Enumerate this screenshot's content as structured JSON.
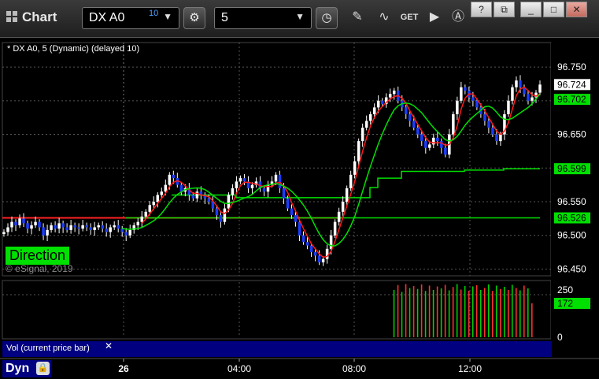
{
  "app": {
    "title": "Chart"
  },
  "toolbar": {
    "symbol": "DX A0",
    "symbol_superscript": "10",
    "interval": "5",
    "icons": [
      "gear-icon",
      "clock-icon",
      "pencil-icon",
      "study-icon",
      "get-icon",
      "play-icon",
      "alert-icon"
    ]
  },
  "window_buttons": [
    "?",
    "⧉",
    "_",
    "□",
    "✕"
  ],
  "chart_header": "* DX A0, 5 (Dynamic) (delayed 10)",
  "direction_label": "Direction",
  "copyright": "© eSignal, 2019",
  "volume_pane": {
    "label": "Vol (current price bar)",
    "close": "✕",
    "current_value": "172",
    "zero_label": "0",
    "level_label": "250"
  },
  "dyn_badge": "Dyn",
  "chart_data": {
    "type": "candlestick",
    "x_ticks": [
      "26",
      "04:00",
      "08:00",
      "12:00"
    ],
    "y_ticks": [
      "96.750",
      "96.700",
      "96.650",
      "96.600",
      "96.550",
      "96.500",
      "96.450"
    ],
    "ylim": [
      96.44,
      96.77
    ],
    "price_labels": [
      {
        "value": "96.724",
        "color": "#ffffff"
      },
      {
        "value": "96.702",
        "color": "#00e000"
      },
      {
        "value": "96.599",
        "color": "#00e000"
      },
      {
        "value": "96.526",
        "color": "#00e000"
      }
    ],
    "horizontal_levels": [
      {
        "value": 96.526,
        "color": "#ff2020",
        "segment": "pre"
      },
      {
        "value": 96.526,
        "color": "#00e000",
        "segment": "post"
      }
    ],
    "closes": [
      96.505,
      96.512,
      96.52,
      96.515,
      96.525,
      96.518,
      96.51,
      96.515,
      96.52,
      96.512,
      96.5,
      96.508,
      96.515,
      96.51,
      96.518,
      96.512,
      96.508,
      96.515,
      96.512,
      96.51,
      96.515,
      96.512,
      96.508,
      96.512,
      96.515,
      96.51,
      96.505,
      96.512,
      96.515,
      96.51,
      96.505,
      96.5,
      96.508,
      96.515,
      96.52,
      96.528,
      96.535,
      96.545,
      96.55,
      96.56,
      96.565,
      96.575,
      96.59,
      96.585,
      96.575,
      96.565,
      96.57,
      96.56,
      96.555,
      96.565,
      96.56,
      96.555,
      96.55,
      96.54,
      96.53,
      96.52,
      96.54,
      96.56,
      96.57,
      96.58,
      96.585,
      96.58,
      96.57,
      96.575,
      96.58,
      96.57,
      96.565,
      96.575,
      96.58,
      96.59,
      96.57,
      96.555,
      96.54,
      96.53,
      96.52,
      96.5,
      96.49,
      96.485,
      96.475,
      96.47,
      96.46,
      96.465,
      96.48,
      96.5,
      96.52,
      96.535,
      96.55,
      96.57,
      96.59,
      96.61,
      96.64,
      96.66,
      96.67,
      96.68,
      96.69,
      96.7,
      96.695,
      96.705,
      96.71,
      96.715,
      96.7,
      96.69,
      96.68,
      96.67,
      96.66,
      96.65,
      96.64,
      96.63,
      96.635,
      96.645,
      96.64,
      96.63,
      96.62,
      96.65,
      96.68,
      96.7,
      96.72,
      96.715,
      96.705,
      96.7,
      96.69,
      96.68,
      96.67,
      96.66,
      96.65,
      96.64,
      96.65,
      96.68,
      96.7,
      96.72,
      96.73,
      96.72,
      96.71,
      96.7,
      96.705,
      96.712,
      96.724
    ],
    "volume": {
      "start_index": 99,
      "values": [
        240,
        265,
        230,
        270,
        250,
        260,
        245,
        268,
        235,
        262,
        240,
        258,
        248,
        266,
        238,
        255,
        270,
        242,
        260,
        236,
        258,
        264,
        240,
        250,
        268,
        235,
        262,
        245,
        256,
        240,
        266,
        250,
        238,
        262,
        248,
        172
      ]
    }
  }
}
